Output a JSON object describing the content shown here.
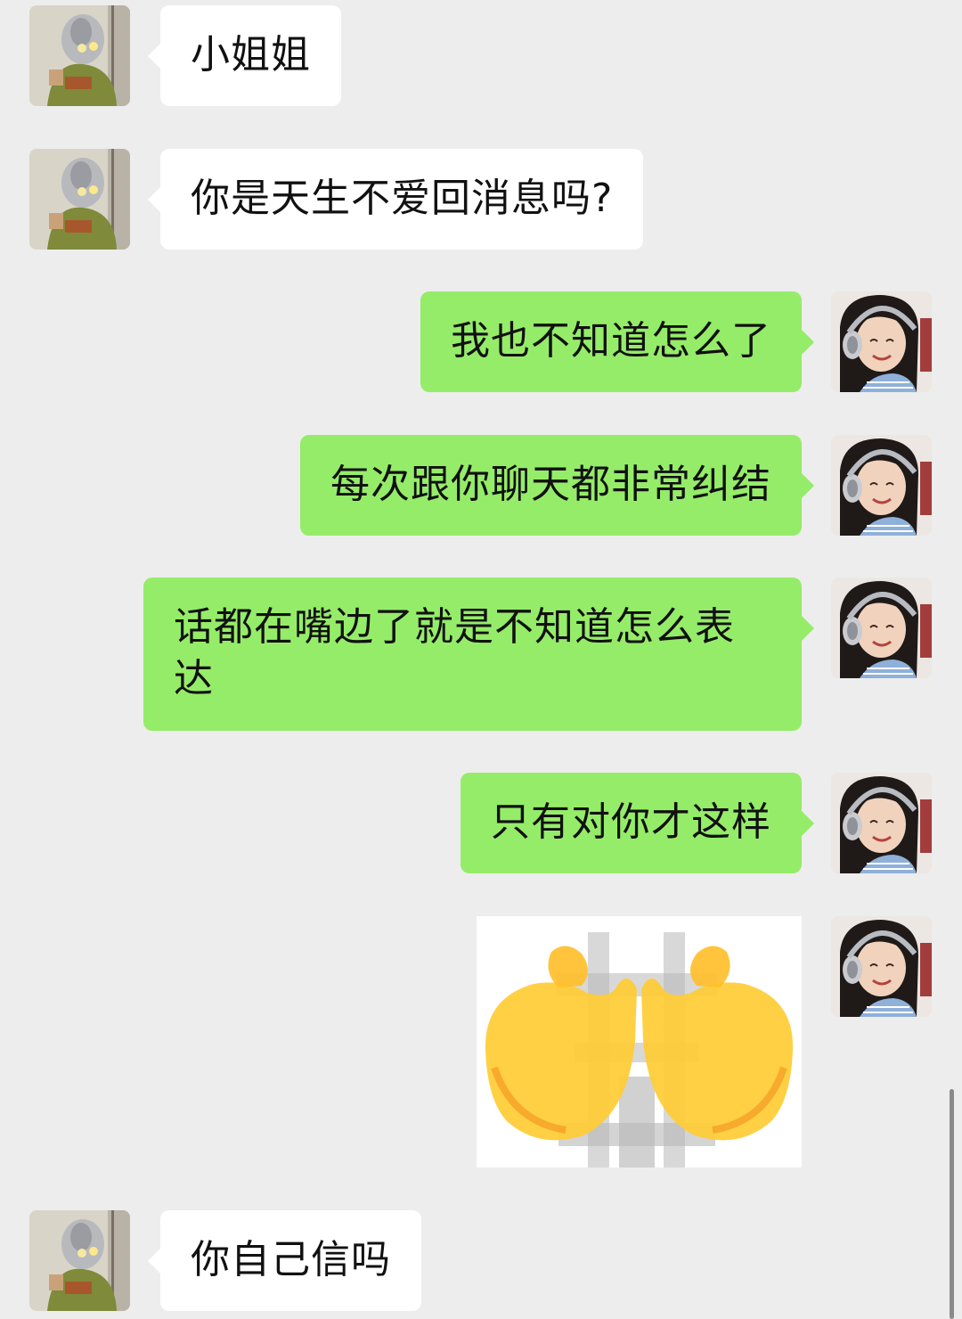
{
  "chat": {
    "messages": [
      {
        "sender": "contact",
        "text": "小姐姐"
      },
      {
        "sender": "contact",
        "text": "你是天生不爱回消息吗?"
      },
      {
        "sender": "me",
        "text": "我也不知道怎么了"
      },
      {
        "sender": "me",
        "text": "每次跟你聊天都非常纠结"
      },
      {
        "sender": "me",
        "text": "话都在嘴边了就是不知道怎么表达"
      },
      {
        "sender": "me",
        "text": "只有对你才这样"
      },
      {
        "sender": "me",
        "type": "sticker",
        "sticker": "cupped-hands-sticker"
      },
      {
        "sender": "contact",
        "text": "你自己信吗"
      }
    ]
  },
  "colors": {
    "background": "#ededed",
    "incoming_bubble": "#ffffff",
    "outgoing_bubble": "#95ec69",
    "text": "#111111"
  }
}
